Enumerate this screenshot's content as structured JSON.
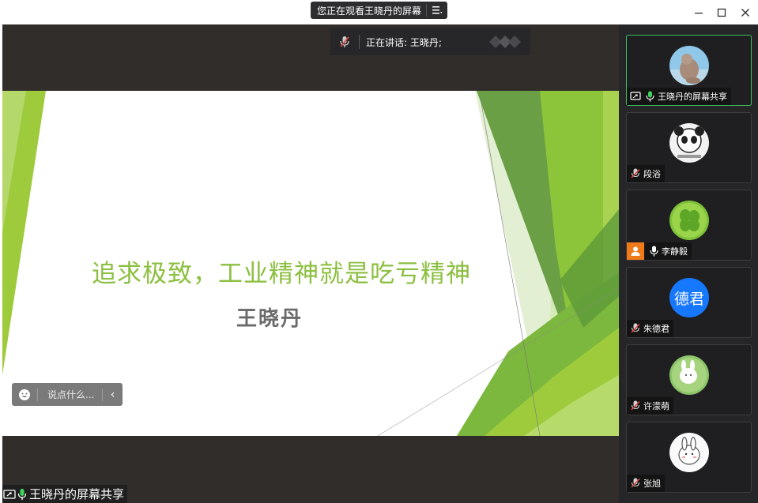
{
  "titlebar": {
    "share_status": "您正在观看王晓丹的屏幕",
    "menu_icon": "list-menu-icon"
  },
  "speaker": {
    "text": "正在讲话: 王晓丹;"
  },
  "slide": {
    "title": "追求极致，工业精神就是吃亏精神",
    "author": "王晓丹",
    "colors": {
      "green_light": "#9dcb3c",
      "green_dark": "#5e9a3a",
      "title": "#8bbf3f"
    }
  },
  "chat": {
    "placeholder": "说点什么..."
  },
  "bottom": {
    "label": "王晓丹的屏幕共享"
  },
  "participants": [
    {
      "name": "王晓丹的屏幕共享",
      "mic": "on",
      "avatar": "seal-photo",
      "active": true
    },
    {
      "name": "段浴",
      "mic": "muted",
      "avatar": "panda-meme"
    },
    {
      "name": "李静毅",
      "mic": "on",
      "avatar": "clover-photo"
    },
    {
      "name": "朱德君",
      "mic": "muted",
      "avatar_text": "德君",
      "avatar": "initials"
    },
    {
      "name": "许濛萌",
      "mic": "muted",
      "avatar": "bunny-green"
    },
    {
      "name": "张旭",
      "mic": "muted",
      "avatar": "bunny-white"
    }
  ]
}
